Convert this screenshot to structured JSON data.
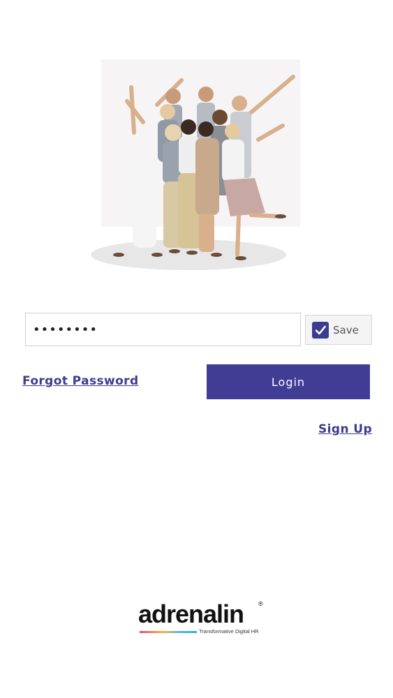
{
  "login": {
    "password_value": "••••••••",
    "save_label": "Save",
    "save_checked": true,
    "forgot_label": "Forgot Password",
    "login_label": "Login",
    "signup_label": "Sign Up"
  },
  "brand": {
    "name": "adrenalin",
    "registered": "®",
    "tagline": "Transformative Digital HR"
  },
  "colors": {
    "accent": "#413d95",
    "link": "#3d3b8e"
  }
}
